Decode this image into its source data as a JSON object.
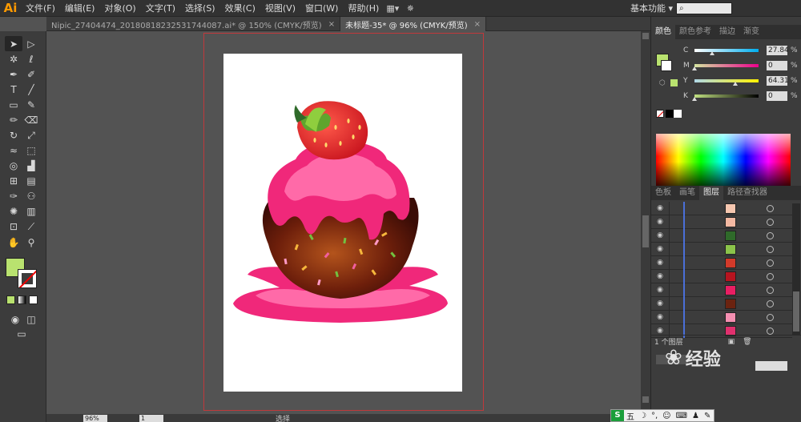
{
  "app": {
    "logo": "Ai",
    "workspace": "基本功能",
    "workspace_arrow": "▾"
  },
  "menu": [
    "文件(F)",
    "编辑(E)",
    "对象(O)",
    "文字(T)",
    "选择(S)",
    "效果(C)",
    "视图(V)",
    "窗口(W)",
    "帮助(H)"
  ],
  "tabs": [
    {
      "label": "Nipic_27404474_20180818232531744087.ai* @ 150% (CMYK/预览)",
      "close": "×"
    },
    {
      "label": "未标题-35* @ 96% (CMYK/预览)",
      "close": "×"
    }
  ],
  "color_panel": {
    "tabs": [
      "颜色",
      "颜色参考",
      "描边",
      "渐变"
    ],
    "sliders": [
      {
        "label": "C",
        "value": "27.84",
        "unit": "%",
        "level": 0.28,
        "gradient": "linear-gradient(to right,#fff,#00aeef)"
      },
      {
        "label": "M",
        "value": "0",
        "unit": "%",
        "level": 0,
        "gradient": "linear-gradient(to right,#d4e6a0,#ec008c)"
      },
      {
        "label": "Y",
        "value": "64.31",
        "unit": "%",
        "level": 0.64,
        "gradient": "linear-gradient(to right,#b0d8e8,#fff200)"
      },
      {
        "label": "K",
        "value": "0",
        "unit": "%",
        "level": 0,
        "gradient": "linear-gradient(to right,#c0e080,#000)"
      }
    ]
  },
  "layers_panel": {
    "tabs": [
      "色板",
      "画笔",
      "图层",
      "路径查找器"
    ],
    "row_count": 10,
    "thumb_colors": [
      "#f6c7b0",
      "#f3b8a2",
      "#2f6a2a",
      "#8bc34a",
      "#d23a2a",
      "#b7141f",
      "#e91e63",
      "#6b2310",
      "#f48fb1",
      "#e0306e"
    ],
    "footer_text": "1 个图层"
  },
  "status": {
    "zoom": "96%",
    "page": "1",
    "tool": "选择"
  },
  "colors": {
    "fill": "#b9e26f",
    "accent": "#ff9a00",
    "artboard_border": "#c0393b"
  },
  "ime": {
    "logo": "S",
    "items": [
      "五",
      "☽",
      "°,",
      "☺",
      "⌨",
      "♟",
      "✎"
    ]
  },
  "watermark": {
    "text": "经验"
  }
}
